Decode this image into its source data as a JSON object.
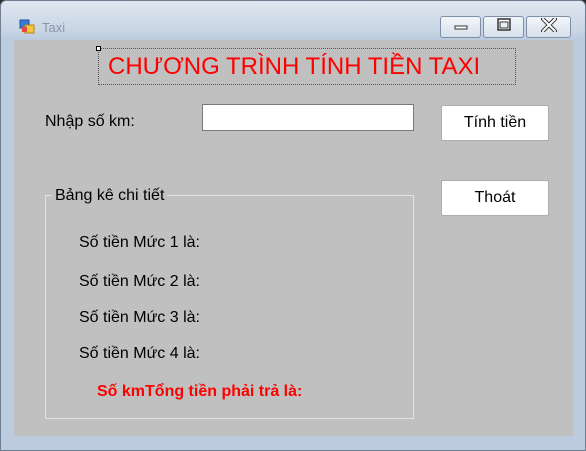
{
  "window": {
    "title": "Taxi"
  },
  "form": {
    "heading": "CHƯƠNG TRÌNH TÍNH TIỀN TAXI",
    "km_label": "Nhập số km:",
    "km_input_value": "",
    "calculate_button": "Tính tiền",
    "exit_button": "Thoát",
    "detail_group": {
      "title": "Bảng kê chi tiết",
      "level1": "Số tiền Mức 1 là:",
      "level2": "Số tiền Mức 2 là:",
      "level3": "Số tiền Mức 3 là:",
      "level4": "Số tiền Mức 4 là:",
      "total": "Số kmTổng tiền phải trả là:"
    }
  },
  "colors": {
    "heading": "#ff0000",
    "form_background": "#c0c0c0"
  },
  "icons": {
    "app": "windows-form-icon",
    "minimize": "minimize-icon",
    "maximize": "maximize-icon",
    "close": "close-icon"
  }
}
